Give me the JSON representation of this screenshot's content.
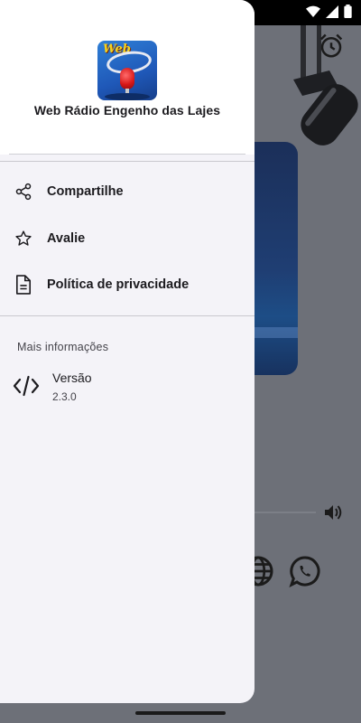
{
  "drawer": {
    "app_title": "Web Rádio Engenho das Lajes",
    "logo_text": "Web Rádio Engenho das Lajes",
    "menu": [
      {
        "label": "Compartilhe",
        "icon": "share-icon"
      },
      {
        "label": "Avalie",
        "icon": "star-icon"
      },
      {
        "label": "Política de privacidade",
        "icon": "document-icon"
      }
    ],
    "section_heading": "Mais informações",
    "version": {
      "label": "Versão",
      "value": "2.3.0",
      "icon": "code-icon"
    }
  },
  "background": {
    "icons": [
      "alarm-icon",
      "volume-icon",
      "globe-icon",
      "whatsapp-icon"
    ]
  },
  "colors": {
    "drawer_bg": "#f4f3f8",
    "header_bg": "#ffffff",
    "scrim": "#6d7078",
    "text": "#1c1b1f"
  }
}
